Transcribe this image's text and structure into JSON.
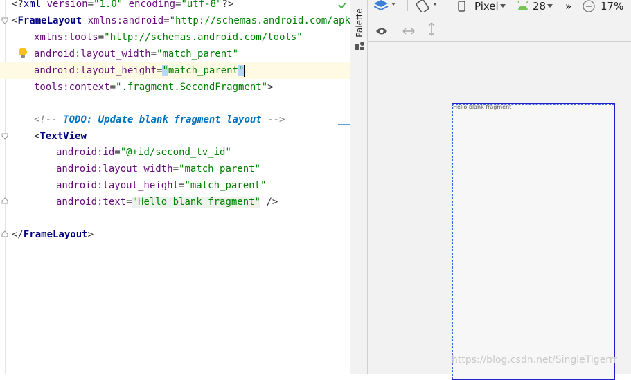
{
  "editor": {
    "lines": {
      "l1": {
        "open": "<?",
        "tag": "xml",
        "a1": " version",
        "eq1": "=",
        "v1": "\"1.0\"",
        "a2": " encoding",
        "eq2": "=",
        "v2": "\"utf-8\"",
        "close": "?>"
      },
      "l2": {
        "open": "<",
        "tag": "FrameLayout",
        "a1": " xmlns:android",
        "eq1": "=",
        "v1": "\"http://schemas.android.com/apk/re"
      },
      "l3": {
        "a1": "xmlns:tools",
        "eq1": "=",
        "v1": "\"http://schemas.android.com/tools\""
      },
      "l4": {
        "a1": "android:layout_width",
        "eq1": "=",
        "v1": "\"match_parent\""
      },
      "l5": {
        "a1": "android:layout_height",
        "eq1": "=",
        "q1": "\"",
        "v1": "match_parent",
        "q2": "\""
      },
      "l6": {
        "a1": "tools:context",
        "eq1": "=",
        "v1": "\".fragment.SecondFragment\"",
        "close": ">"
      },
      "l8": {
        "open": "<!-- ",
        "todo": "TODO: Update blank fragment layout",
        "close": " -->"
      },
      "l9": {
        "open": "<",
        "tag": "TextView"
      },
      "l10": {
        "a1": "android:id",
        "eq1": "=",
        "v1": "\"@+id/second_tv_id\""
      },
      "l11": {
        "a1": "android:layout_width",
        "eq1": "=",
        "v1": "\"match_parent\""
      },
      "l12": {
        "a1": "android:layout_height",
        "eq1": "=",
        "v1": "\"match_parent\""
      },
      "l13": {
        "a1": "android:text",
        "eq1": "=",
        "v1": "\"Hello blank fragment\"",
        "close": " />"
      },
      "l15": {
        "open": "</",
        "tag": "FrameLayout",
        "close": ">"
      }
    }
  },
  "palette": {
    "label": "Palette"
  },
  "toolbar": {
    "device": "Pixel",
    "api": "28",
    "more": "»",
    "zoom": "17%"
  },
  "preview": {
    "text": "Hello blank fragment"
  },
  "watermark": "https://blog.csdn.net/SingleTigerrr",
  "colors": {
    "accent": "#1e22c8",
    "highlight": "#fffae3",
    "android_green": "#78c257",
    "layers_blue": "#3d7fd6"
  }
}
